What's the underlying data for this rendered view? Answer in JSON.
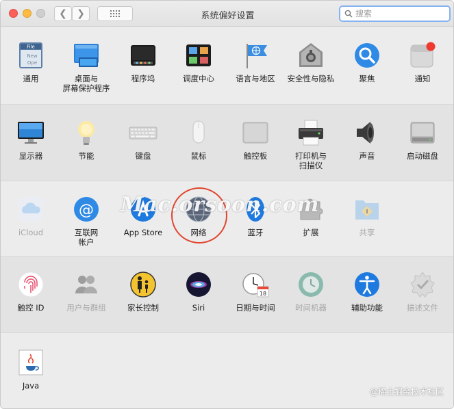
{
  "window": {
    "title": "系统偏好设置"
  },
  "search": {
    "placeholder": "搜索"
  },
  "rows": [
    {
      "items": [
        {
          "label": "通用",
          "icon": "general-icon"
        },
        {
          "label": "桌面与\n屏幕保护程序",
          "icon": "desktop-screensaver-icon"
        },
        {
          "label": "程序坞",
          "icon": "dock-icon"
        },
        {
          "label": "调度中心",
          "icon": "mission-control-icon"
        },
        {
          "label": "语言与地区",
          "icon": "language-region-icon"
        },
        {
          "label": "安全性与隐私",
          "icon": "security-privacy-icon"
        },
        {
          "label": "聚焦",
          "icon": "spotlight-icon"
        },
        {
          "label": "通知",
          "icon": "notifications-icon"
        }
      ]
    },
    {
      "items": [
        {
          "label": "显示器",
          "icon": "displays-icon"
        },
        {
          "label": "节能",
          "icon": "energy-saver-icon"
        },
        {
          "label": "键盘",
          "icon": "keyboard-icon"
        },
        {
          "label": "鼠标",
          "icon": "mouse-icon"
        },
        {
          "label": "触控板",
          "icon": "trackpad-icon"
        },
        {
          "label": "打印机与\n扫描仪",
          "icon": "printers-scanners-icon"
        },
        {
          "label": "声音",
          "icon": "sound-icon"
        },
        {
          "label": "启动磁盘",
          "icon": "startup-disk-icon"
        }
      ]
    },
    {
      "items": [
        {
          "label": "iCloud",
          "icon": "icloud-icon",
          "disabled": true
        },
        {
          "label": "互联网\n帐户",
          "icon": "internet-accounts-icon"
        },
        {
          "label": "App Store",
          "icon": "app-store-icon"
        },
        {
          "label": "网络",
          "icon": "network-icon"
        },
        {
          "label": "蓝牙",
          "icon": "bluetooth-icon"
        },
        {
          "label": "扩展",
          "icon": "extensions-icon"
        },
        {
          "label": "共享",
          "icon": "sharing-icon",
          "disabled": true
        }
      ]
    },
    {
      "items": [
        {
          "label": "触控 ID",
          "icon": "touch-id-icon"
        },
        {
          "label": "用户与群组",
          "icon": "users-groups-icon",
          "disabled": true
        },
        {
          "label": "家长控制",
          "icon": "parental-controls-icon"
        },
        {
          "label": "Siri",
          "icon": "siri-icon"
        },
        {
          "label": "日期与时间",
          "icon": "date-time-icon"
        },
        {
          "label": "时间机器",
          "icon": "time-machine-icon",
          "disabled": true
        },
        {
          "label": "辅助功能",
          "icon": "accessibility-icon"
        },
        {
          "label": "描述文件",
          "icon": "profiles-icon",
          "disabled": true
        }
      ]
    },
    {
      "items": [
        {
          "label": "Java",
          "icon": "java-icon"
        }
      ]
    }
  ],
  "icon_texts": {
    "general_file": "File",
    "general_new": "New",
    "general_ope": "Ope",
    "calendar_day": "18"
  },
  "overlay": {
    "watermark": "Mac.orsoon.com",
    "credit": "@稀土掘金技术社区"
  },
  "colors": {
    "highlight_ring": "#e0452f",
    "accent_blue": "#1f7ae0",
    "notification_badge": "#f03a2f"
  }
}
